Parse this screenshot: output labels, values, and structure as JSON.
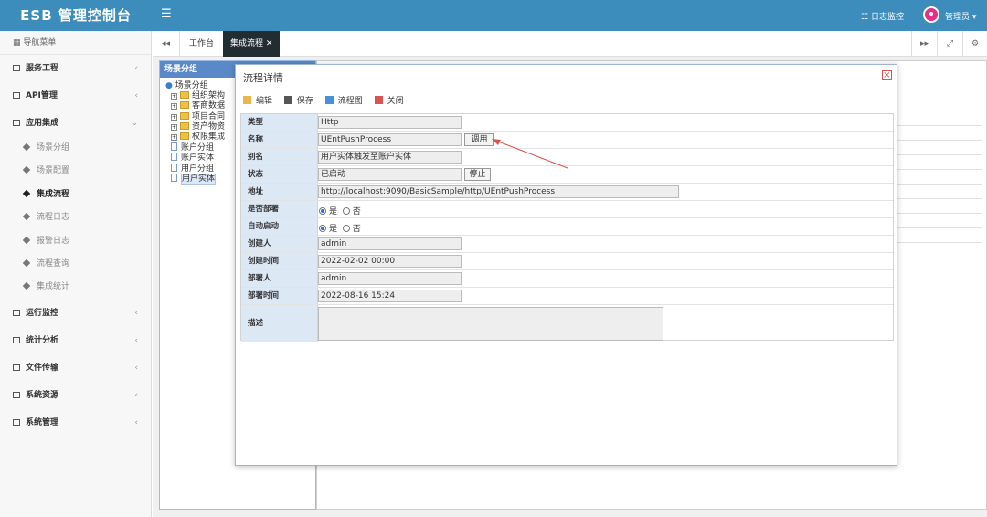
{
  "app": {
    "title": "ESB 管理控制台"
  },
  "header": {
    "log_monitor": "日志监控",
    "user": "管理员"
  },
  "sidebar": {
    "header": "导航菜单",
    "items": [
      {
        "label": "服务工程"
      },
      {
        "label": "API管理"
      },
      {
        "label": "应用集成"
      },
      {
        "label": "运行监控"
      },
      {
        "label": "统计分析"
      },
      {
        "label": "文件传输"
      },
      {
        "label": "系统资源"
      },
      {
        "label": "系统管理"
      }
    ],
    "subitems": [
      {
        "label": "场景分组"
      },
      {
        "label": "场景配置"
      },
      {
        "label": "集成流程"
      },
      {
        "label": "流程日志"
      },
      {
        "label": "报警日志"
      },
      {
        "label": "流程查询"
      },
      {
        "label": "集成统计"
      }
    ],
    "active_sub": "集成流程"
  },
  "tabs": [
    {
      "label": "工作台"
    },
    {
      "label": "集成流程"
    }
  ],
  "tree": {
    "header": "场景分组",
    "root": "场景分组",
    "folders": [
      "组织架构",
      "客商数据",
      "项目合同",
      "资产物资",
      "权限集成"
    ],
    "docs": [
      "账户分组",
      "账户实体",
      "用户分组",
      "用户实体"
    ],
    "selected": "用户实体"
  },
  "dialog": {
    "title": "流程详情",
    "toolbar": {
      "edit": "编辑",
      "save": "保存",
      "flow": "流程图",
      "close": "关闭"
    },
    "fields": {
      "type": {
        "label": "类型",
        "value": "Http"
      },
      "name": {
        "label": "名称",
        "value": "UEntPushProcess",
        "button": "调用"
      },
      "alias": {
        "label": "别名",
        "value": "用户实体触发至账户实体"
      },
      "status": {
        "label": "状态",
        "value": "已启动",
        "button": "停止"
      },
      "address": {
        "label": "地址",
        "value": "http://localhost:9090/BasicSample/http/UEntPushProcess"
      },
      "deployed": {
        "label": "是否部署",
        "yes": "是",
        "no": "否"
      },
      "autostart": {
        "label": "自动启动",
        "yes": "是",
        "no": "否"
      },
      "creator": {
        "label": "创建人",
        "value": "admin"
      },
      "created_at": {
        "label": "创建时间",
        "value": "2022-02-02 00:00"
      },
      "deployer": {
        "label": "部署人",
        "value": "admin"
      },
      "deployed_at": {
        "label": "部署时间",
        "value": "2022-08-16 15:24"
      },
      "desc": {
        "label": "描述",
        "value": ""
      }
    }
  },
  "colors": {
    "topbar": "#3c8dbc",
    "active_tab": "#222d32",
    "label_bg": "#dde8f5",
    "panel_head": "#5b89c8",
    "arrow": "#d9534f"
  }
}
